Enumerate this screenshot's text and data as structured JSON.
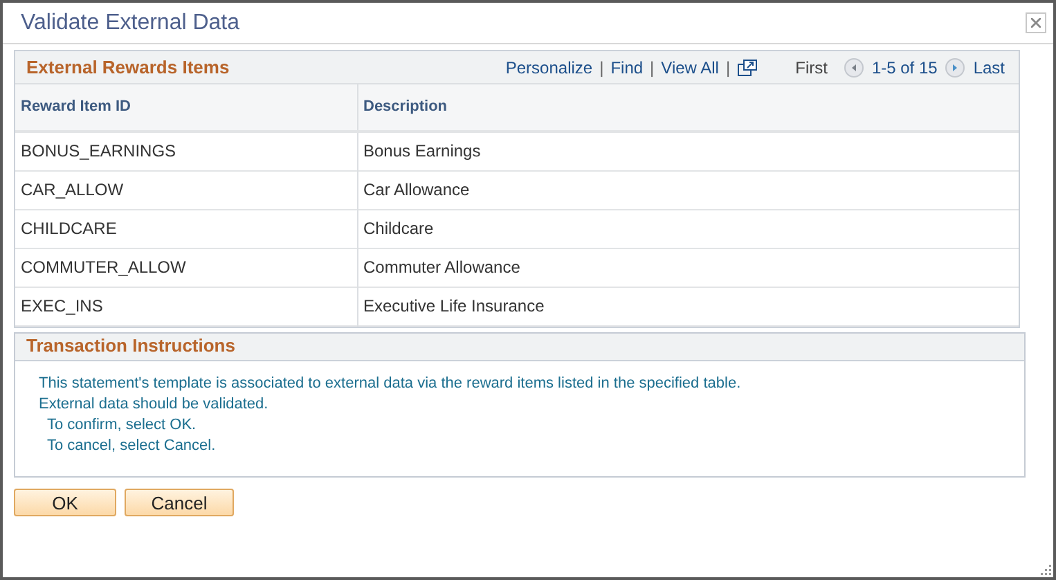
{
  "window": {
    "title": "Validate External Data"
  },
  "grid": {
    "title": "External Rewards Items",
    "links": [
      "Personalize",
      "Find",
      "View All"
    ],
    "separator": "|",
    "pager": {
      "first": "First",
      "range": "1-5 of 15",
      "last": "Last"
    },
    "columns": [
      "Reward Item ID",
      "Description"
    ],
    "rows": [
      {
        "id": "BONUS_EARNINGS",
        "description": "Bonus Earnings"
      },
      {
        "id": "CAR_ALLOW",
        "description": "Car Allowance"
      },
      {
        "id": "CHILDCARE",
        "description": "Childcare"
      },
      {
        "id": "COMMUTER_ALLOW",
        "description": "Commuter Allowance"
      },
      {
        "id": "EXEC_INS",
        "description": "Executive Life Insurance"
      }
    ]
  },
  "instructions": {
    "title": "Transaction Instructions",
    "lines": [
      {
        "text": "This statement's template is associated to external data via the reward items listed in the specified table.",
        "indented": false
      },
      {
        "text": "External data should be validated.",
        "indented": false
      },
      {
        "text": "To confirm, select OK.",
        "indented": true
      },
      {
        "text": "To cancel, select Cancel.",
        "indented": true
      }
    ]
  },
  "buttons": [
    "OK",
    "Cancel"
  ]
}
